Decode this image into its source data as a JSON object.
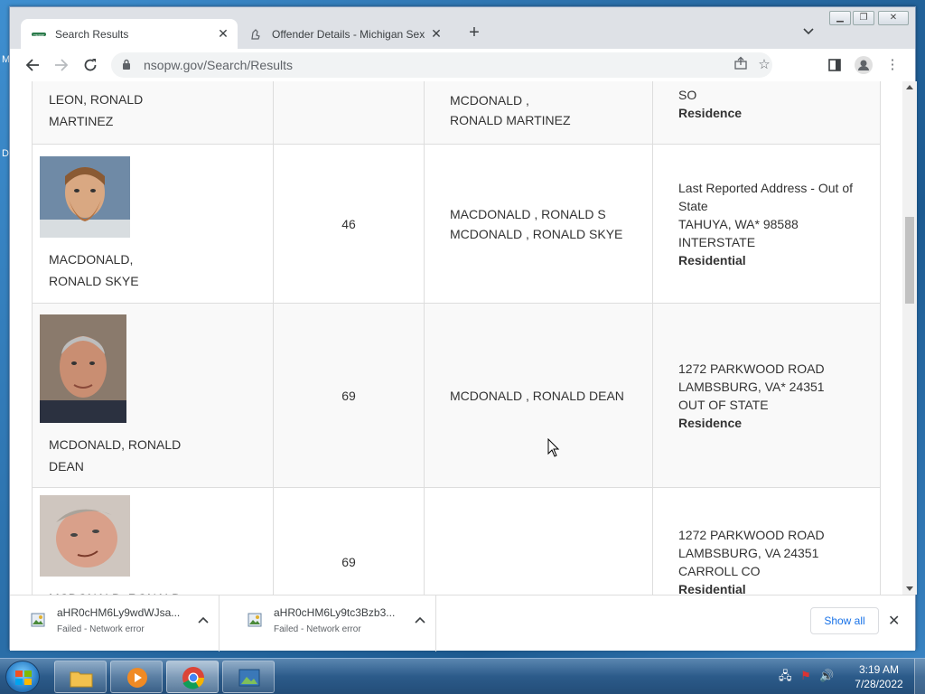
{
  "browser": {
    "tabs": [
      {
        "title": "Search Results",
        "favicon_text": "nsopw",
        "active": true
      },
      {
        "title": "Offender Details - Michigan Sex Offender",
        "active": false
      }
    ],
    "url": "nsopw.gov/Search/Results"
  },
  "results": {
    "rows": [
      {
        "name": "LEON, RONALD MARTINEZ",
        "name_lines": [
          "LEON, RONALD",
          "MARTINEZ"
        ],
        "age": "",
        "aliases": [
          "MCDONALD ,",
          "RONALD MARTINEZ"
        ],
        "address": [
          "SO"
        ],
        "address_type": "Residence"
      },
      {
        "name": "MACDONALD, RONALD SKYE",
        "name_lines": [
          "MACDONALD,",
          "RONALD SKYE"
        ],
        "age": "46",
        "aliases": [
          "MACDONALD , RONALD S",
          "MCDONALD , RONALD SKYE"
        ],
        "address": [
          "Last Reported Address - Out of",
          "State",
          "TAHUYA, WA*  98588",
          "INTERSTATE"
        ],
        "address_type": "Residential"
      },
      {
        "name": "MCDONALD, RONALD DEAN",
        "name_lines": [
          "MCDONALD, RONALD",
          "DEAN"
        ],
        "age": "69",
        "aliases": [
          "MCDONALD , RONALD  DEAN"
        ],
        "address": [
          "1272 PARKWOOD ROAD",
          "LAMBSBURG, VA*  24351",
          "OUT OF STATE"
        ],
        "address_type": "Residence"
      },
      {
        "name": "MCDONALD, RONALD",
        "name_lines": [
          "MCDONALD, RONALD"
        ],
        "age": "69",
        "aliases": [],
        "address": [
          "1272 PARKWOOD ROAD",
          "LAMBSBURG, VA  24351",
          "CARROLL CO"
        ],
        "address_type": "Residential"
      }
    ]
  },
  "downloads": {
    "items": [
      {
        "name": "aHR0cHM6Ly9wdWJsa...",
        "status": "Failed - Network error"
      },
      {
        "name": "aHR0cHM6Ly9tc3Bzb3...",
        "status": "Failed - Network error"
      }
    ],
    "show_all": "Show all"
  },
  "taskbar": {
    "time": "3:19 AM",
    "date": "7/28/2022"
  },
  "desktop": {
    "left_chars": [
      "M",
      "D"
    ]
  },
  "colors": {
    "link_blue": "#1a73e8",
    "taskbar": "#2c5b8a"
  }
}
